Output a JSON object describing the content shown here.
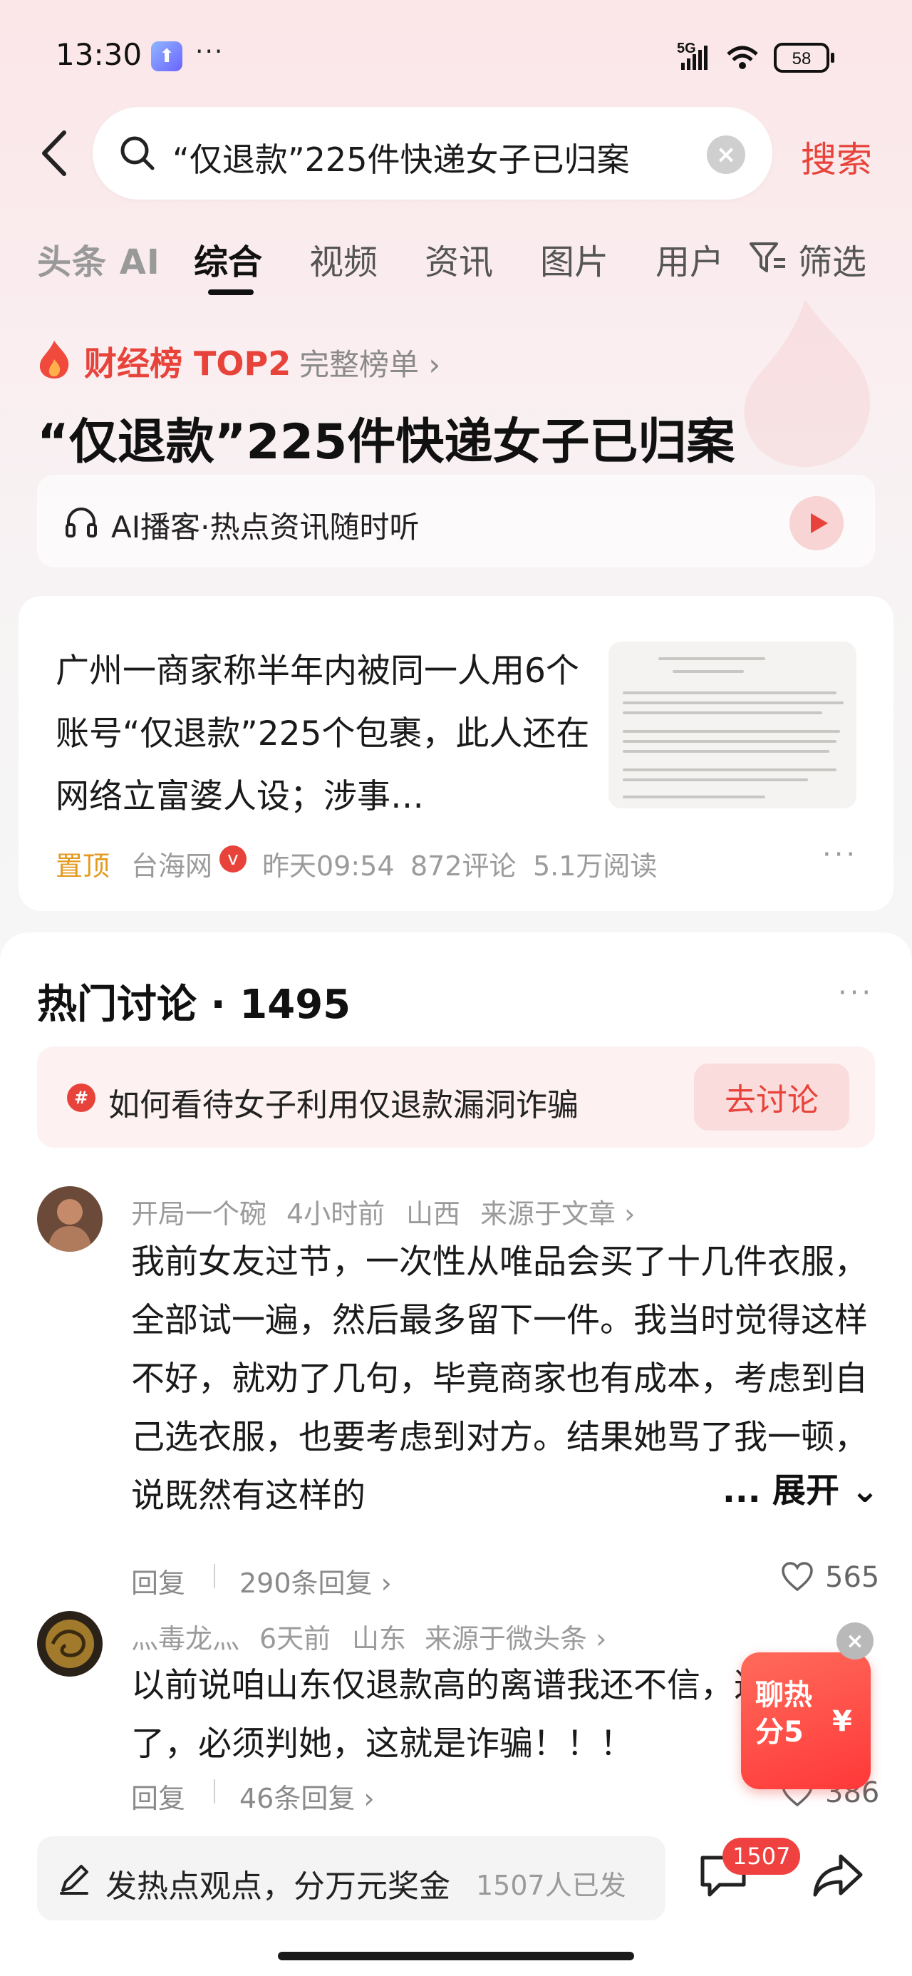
{
  "status_bar": {
    "time": "13:30",
    "app_badge_glyph": "⬆",
    "more": "···",
    "network": "5G",
    "battery": "58"
  },
  "search": {
    "query": "“仅退款”225件快递女子已归案",
    "clear_glyph": "×",
    "button_label": "搜索"
  },
  "tabs": [
    {
      "label": "头条 AI"
    },
    {
      "label": "综合"
    },
    {
      "label": "视频"
    },
    {
      "label": "资讯"
    },
    {
      "label": "图片"
    },
    {
      "label": "用户"
    },
    {
      "label": "筛选"
    }
  ],
  "hot": {
    "rank_label": "财经榜 TOP2",
    "rank_link": "完整榜单 ›",
    "headline": "“仅退款”225件快递女子已归案",
    "podcast": "AI播客·热点资讯随时听"
  },
  "article": {
    "title": "广州一商家称半年内被同一人用6个账号“仅退款”225个包裹，此人还在网络立富婆人设；涉事…",
    "pin": "置顶",
    "source": "台海网",
    "verify_glyph": "v",
    "time": "昨天09:54",
    "comments": "872评论",
    "reads": "5.1万阅读",
    "more": "···"
  },
  "discussion": {
    "title": "热门讨论 · 1495",
    "more": "···",
    "topic": "如何看待女子利用仅退款漏洞诈骗",
    "topic_glyph": "#",
    "topic_button": "去讨论",
    "comments": [
      {
        "user": "开局一个碗",
        "time": "4小时前",
        "region": "山西",
        "source": "来源于文章 ›",
        "text": "我前女友过节，一次性从唯品会买了十几件衣服，全部试一遍，然后最多留下一件。我当时觉得这样不好，就劝了几句，毕竟商家也有成本，考虑到自己选衣服，也要考虑到对方。结果她骂了我一顿，说既然有这样的",
        "expand": "... 展开 ⌄",
        "reply": "回复",
        "replies": "290条回复 ›",
        "likes": "565"
      },
      {
        "user": "灬毒龙灬",
        "time": "6天前",
        "region": "山东",
        "source": "来源于微头条 ›",
        "text": "以前说咱山东仅退款高的离谱我还不信，这下逮着了，必须判她，这就是诈骗！！！",
        "reply": "回复",
        "replies": "46条回复 ›",
        "likes": "386"
      }
    ]
  },
  "promo": {
    "text": "聊热 分5",
    "yen": "¥",
    "close_glyph": "×"
  },
  "bottom": {
    "compose": "发热点观点，分万元奖金",
    "compose_count": "1507人已发",
    "comment_badge": "1507"
  },
  "colors": {
    "accent": "#e8433a",
    "pin": "#e39a20",
    "badge": "#f04141"
  }
}
